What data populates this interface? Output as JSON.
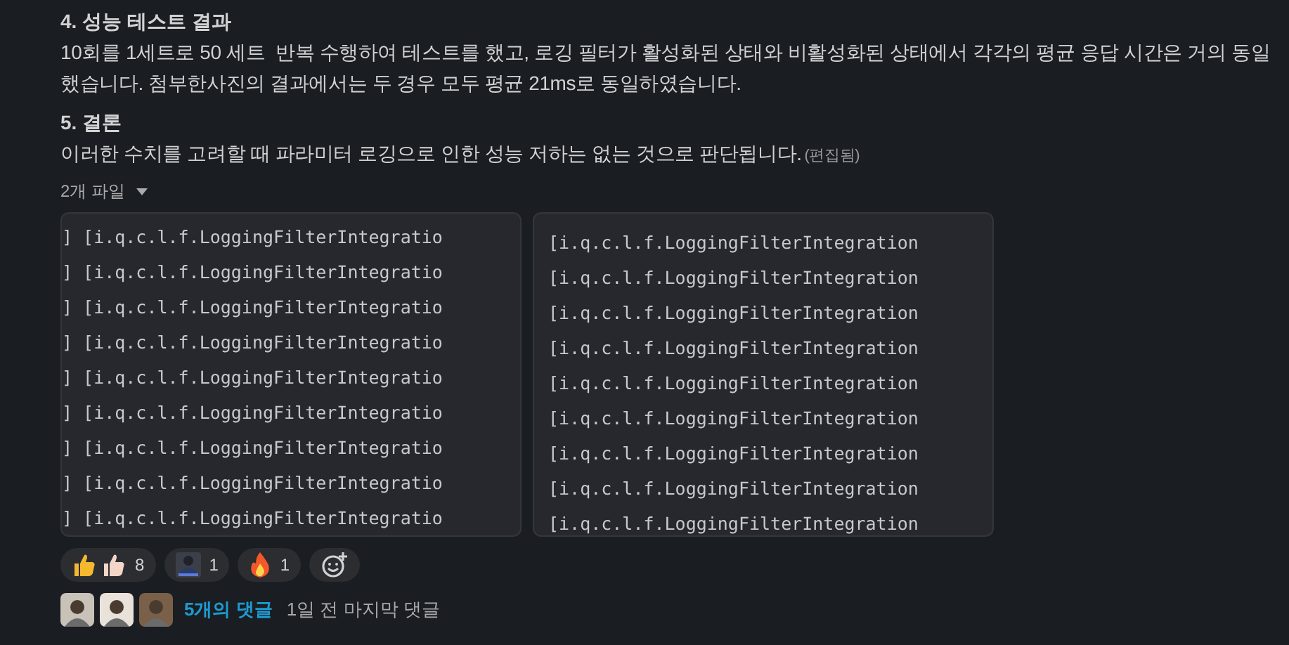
{
  "sections": [
    {
      "heading": "4. 성능 테스트 결과",
      "lines": [
        "10회를 1세트로 50 세트  반복 수행하여 테스트를 했고, 로깅 필터가 활성화된 상태와 비활성화된 상태에서 각각의 평균 응답 시간은 거의 동일",
        "했습니다. 첨부한사진의 결과에서는 두 경우 모두 평균 21ms로 동일하였습니다."
      ]
    },
    {
      "heading": "5. 결론",
      "lines": [
        "이러한 수치를 고려할 때 파라미터 로깅으로 인한 성능 저하는 없는 것으로 판단됩니다."
      ],
      "edited": "(편집됨)"
    }
  ],
  "files": {
    "label": "2개 파일",
    "expanded": true,
    "images": [
      {
        "lines": [
          "] [i.q.c.l.f.LoggingFilterIntegratio",
          "] [i.q.c.l.f.LoggingFilterIntegratio",
          "] [i.q.c.l.f.LoggingFilterIntegratio",
          "] [i.q.c.l.f.LoggingFilterIntegratio",
          "] [i.q.c.l.f.LoggingFilterIntegratio",
          "] [i.q.c.l.f.LoggingFilterIntegratio",
          "] [i.q.c.l.f.LoggingFilterIntegratio",
          "] [i.q.c.l.f.LoggingFilterIntegratio",
          "] [i.q.c.l.f.LoggingFilterIntegratio"
        ]
      },
      {
        "lines": [
          "[i.q.c.l.f.LoggingFilterIntegration",
          "[i.q.c.l.f.LoggingFilterIntegration",
          "[i.q.c.l.f.LoggingFilterIntegration",
          "[i.q.c.l.f.LoggingFilterIntegration",
          "[i.q.c.l.f.LoggingFilterIntegration",
          "[i.q.c.l.f.LoggingFilterIntegration",
          "[i.q.c.l.f.LoggingFilterIntegration",
          "[i.q.c.l.f.LoggingFilterIntegration",
          "[i.q.c.l.f.LoggingFilterIntegration"
        ]
      }
    ]
  },
  "reactions": [
    {
      "kind": "thumbs",
      "count": "8"
    },
    {
      "kind": "custom",
      "count": "1"
    },
    {
      "kind": "fire",
      "count": "1"
    }
  ],
  "thread": {
    "replies": "5개의 댓글",
    "last_reply": "1일 전 마지막 댓글"
  }
}
